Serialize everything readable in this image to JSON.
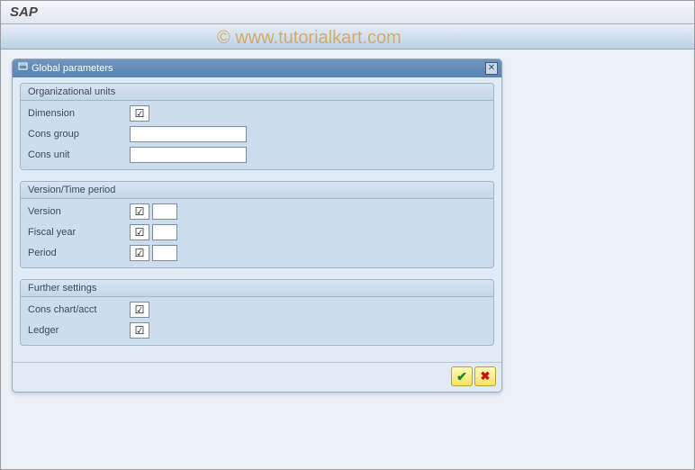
{
  "app": {
    "title": "SAP"
  },
  "watermark": "© www.tutorialkart.com",
  "dialog": {
    "title": "Global parameters",
    "groups": {
      "org": {
        "header": "Organizational units",
        "dimension_label": "Dimension",
        "dimension_checked": true,
        "cons_group_label": "Cons group",
        "cons_group_value": "",
        "cons_unit_label": "Cons unit",
        "cons_unit_value": ""
      },
      "version": {
        "header": "Version/Time period",
        "version_label": "Version",
        "version_checked": true,
        "fiscal_label": "Fiscal year",
        "fiscal_checked": true,
        "period_label": "Period",
        "period_checked": true
      },
      "further": {
        "header": "Further settings",
        "chart_label": "Cons chart/acct",
        "chart_checked": true,
        "ledger_label": "Ledger",
        "ledger_checked": true
      }
    }
  }
}
